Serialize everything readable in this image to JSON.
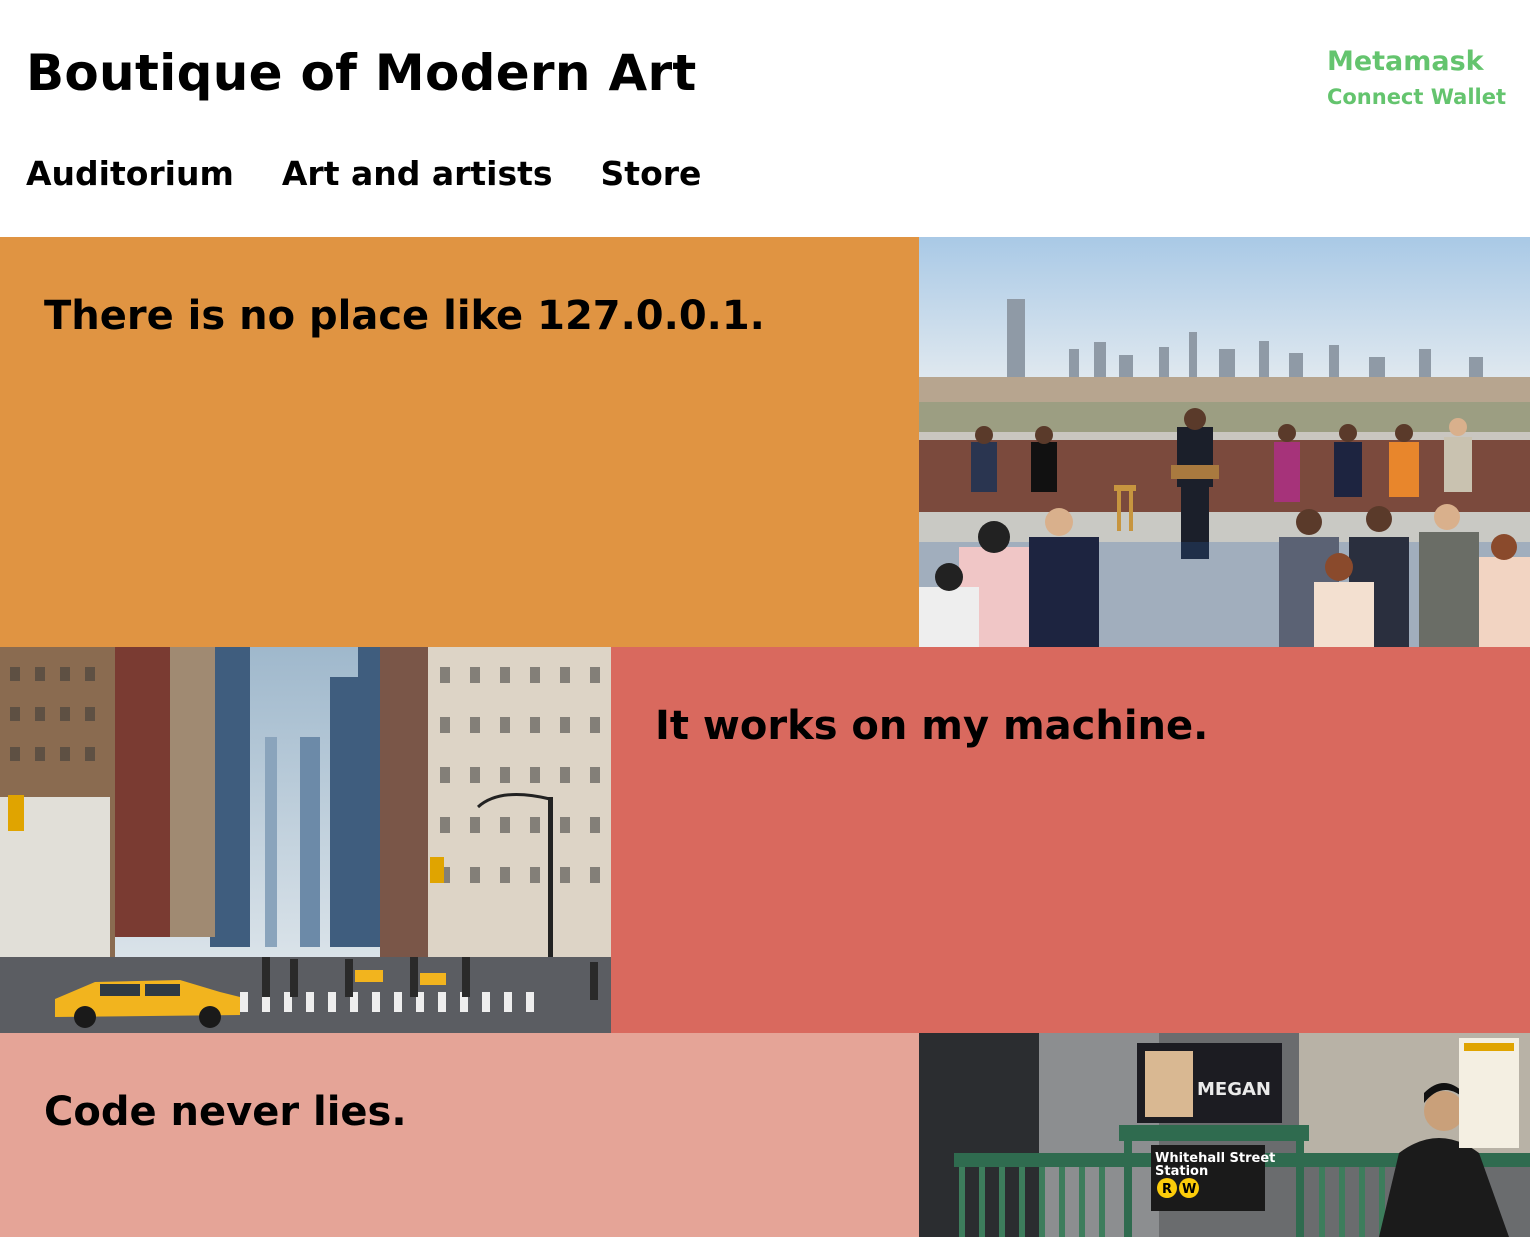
{
  "header": {
    "title": "Boutique of Modern Art"
  },
  "wallet": {
    "name": "Metamask",
    "connect_label": "Connect Wallet",
    "accent_color": "#64c46e"
  },
  "nav": {
    "items": [
      {
        "label": "Auditorium"
      },
      {
        "label": "Art and artists"
      },
      {
        "label": "Store"
      }
    ]
  },
  "sections": [
    {
      "quote": "There is no place like 127.0.0.1.",
      "background": "#e09442",
      "image": "rooftop-press-conference-photo"
    },
    {
      "quote": "It works on my machine.",
      "background": "#d9695e",
      "image": "city-street-taxi-photo"
    },
    {
      "quote": "Code never lies.",
      "background": "#e5a497",
      "image": "subway-entrance-photo",
      "sign_text": {
        "station_line1": "Whitehall Street",
        "station_line2": "Station",
        "poster": "MEGAN",
        "route_r": "R",
        "route_w": "W"
      }
    }
  ]
}
